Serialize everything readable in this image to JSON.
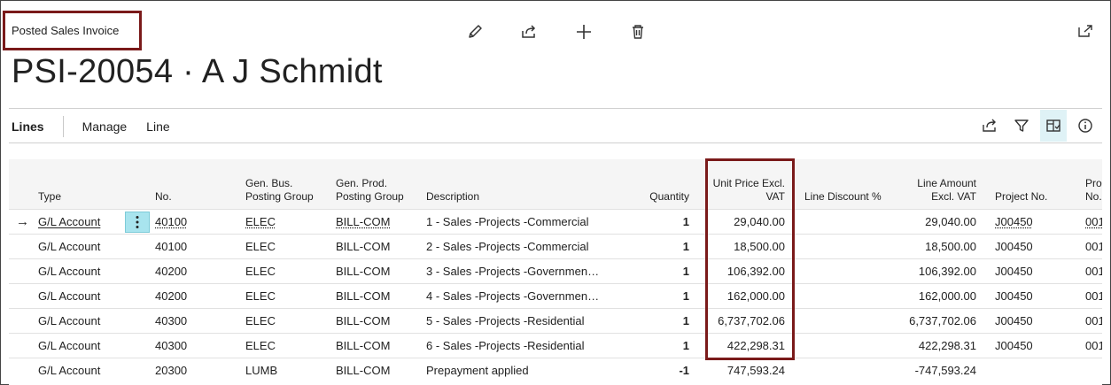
{
  "page": {
    "kind": "Posted Sales Invoice",
    "title": "PSI-20054 · A J Schmidt"
  },
  "top_actions": {
    "icons": [
      "edit-icon",
      "share-icon",
      "new-icon",
      "delete-icon"
    ],
    "popout_icon": "popout-icon"
  },
  "tabs": {
    "lines": "Lines",
    "manage": "Manage",
    "line": "Line"
  },
  "part_actions": {
    "icons": [
      "share-icon",
      "filter-icon",
      "focus-mode-icon",
      "info-icon"
    ]
  },
  "grid": {
    "columns": {
      "type": "Type",
      "no": "No.",
      "gen_bus_1": "Gen. Bus.",
      "gen_bus_2": "Posting Group",
      "gen_prod_1": "Gen. Prod.",
      "gen_prod_2": "Posting Group",
      "description": "Description",
      "quantity": "Quantity",
      "unit_price_1": "Unit Price Excl.",
      "unit_price_2": "VAT",
      "line_discount": "Line Discount %",
      "line_amount_1": "Line Amount",
      "line_amount_2": "Excl. VAT",
      "project_no": "Project No.",
      "pro_1": "Pro",
      "pro_2": "No."
    },
    "rows": [
      {
        "type": "G/L Account",
        "no": "40100",
        "bus": "ELEC",
        "prod": "BILL-COM",
        "desc": "1 - Sales -Projects -Commercial",
        "qty": "1",
        "price": "29,040.00",
        "amount": "29,040.00",
        "project": "J00450",
        "pro": "001"
      },
      {
        "type": "G/L Account",
        "no": "40100",
        "bus": "ELEC",
        "prod": "BILL-COM",
        "desc": "2 - Sales -Projects -Commercial",
        "qty": "1",
        "price": "18,500.00",
        "amount": "18,500.00",
        "project": "J00450",
        "pro": "001"
      },
      {
        "type": "G/L Account",
        "no": "40200",
        "bus": "ELEC",
        "prod": "BILL-COM",
        "desc": "3 - Sales -Projects -Governmen…",
        "qty": "1",
        "price": "106,392.00",
        "amount": "106,392.00",
        "project": "J00450",
        "pro": "001"
      },
      {
        "type": "G/L Account",
        "no": "40200",
        "bus": "ELEC",
        "prod": "BILL-COM",
        "desc": "4 - Sales -Projects -Governmen…",
        "qty": "1",
        "price": "162,000.00",
        "amount": "162,000.00",
        "project": "J00450",
        "pro": "001"
      },
      {
        "type": "G/L Account",
        "no": "40300",
        "bus": "ELEC",
        "prod": "BILL-COM",
        "desc": "5 - Sales -Projects -Residential",
        "qty": "1",
        "price": "6,737,702.06",
        "amount": "6,737,702.06",
        "project": "J00450",
        "pro": "001"
      },
      {
        "type": "G/L Account",
        "no": "40300",
        "bus": "ELEC",
        "prod": "BILL-COM",
        "desc": "6 - Sales -Projects -Residential",
        "qty": "1",
        "price": "422,298.31",
        "amount": "422,298.31",
        "project": "J00450",
        "pro": "001"
      },
      {
        "type": "G/L Account",
        "no": "20300",
        "bus": "LUMB",
        "prod": "BILL-COM",
        "desc": "Prepayment applied",
        "qty": "-1",
        "price": "747,593.24",
        "amount": "-747,593.24",
        "project": "",
        "pro": ""
      }
    ]
  },
  "colors": {
    "highlight_box": "#7a1a1a",
    "selected_action": "#a8e4ee",
    "header_bg": "#f5f5f5"
  }
}
